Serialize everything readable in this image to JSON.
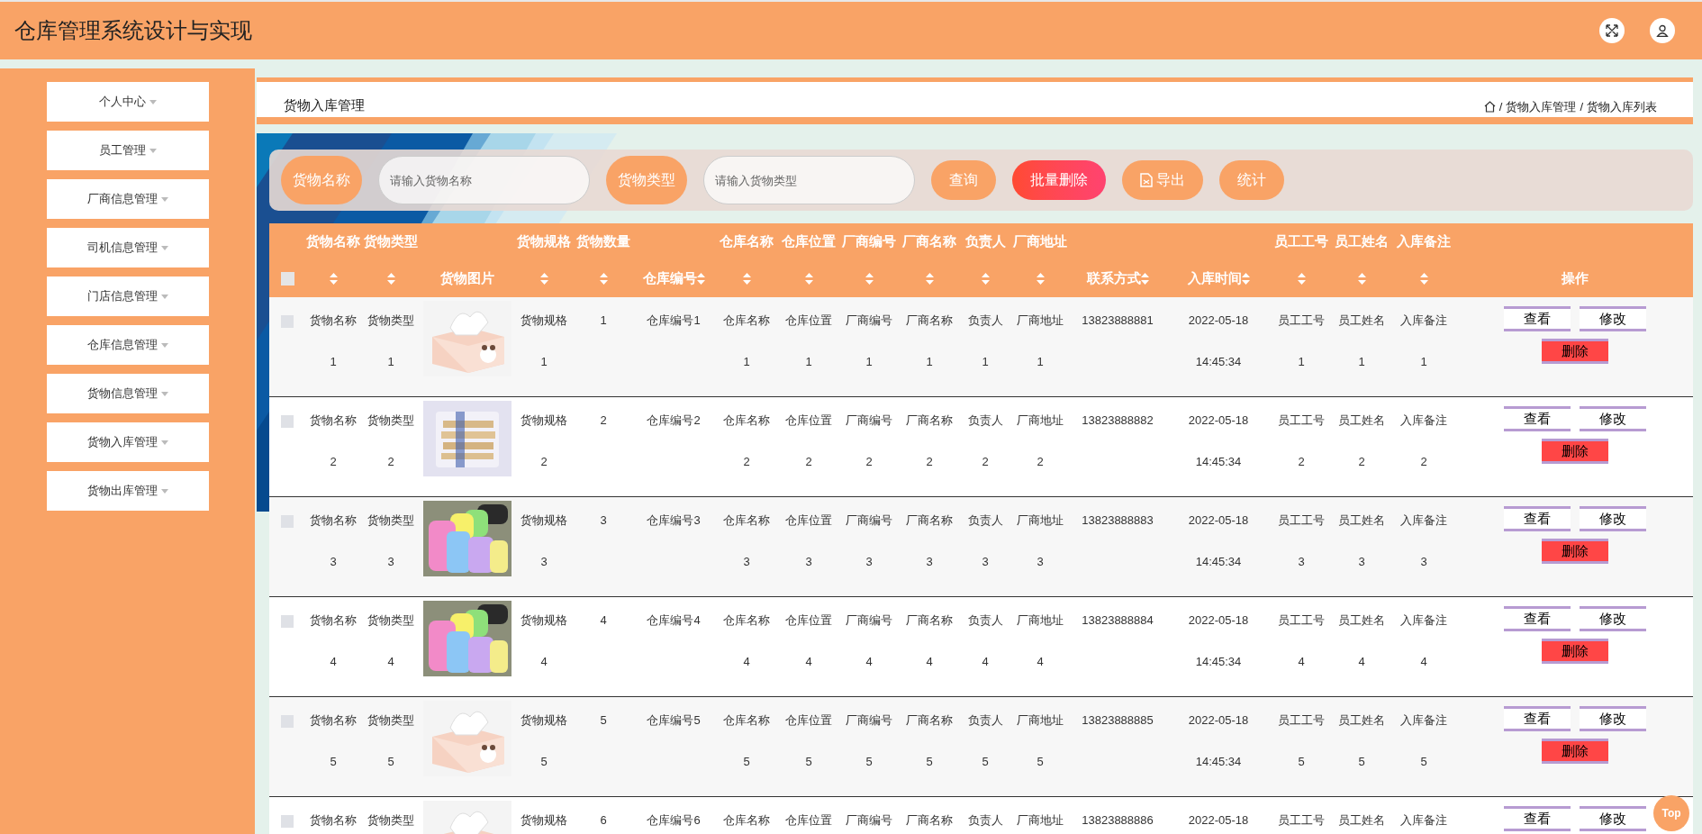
{
  "header": {
    "title": "仓库管理系统设计与实现"
  },
  "sidebar": {
    "items": [
      {
        "label": "个人中心"
      },
      {
        "label": "员工管理"
      },
      {
        "label": "厂商信息管理"
      },
      {
        "label": "司机信息管理"
      },
      {
        "label": "门店信息管理"
      },
      {
        "label": "仓库信息管理"
      },
      {
        "label": "货物信息管理"
      },
      {
        "label": "货物入库管理"
      },
      {
        "label": "货物出库管理"
      }
    ]
  },
  "page_title": "货物入库管理",
  "breadcrumb": {
    "separators": [
      "/",
      "/"
    ],
    "items": [
      "货物入库管理",
      "货物入库列表"
    ]
  },
  "search": {
    "fields": [
      {
        "label": "货物名称",
        "placeholder": "请输入货物名称"
      },
      {
        "label": "货物类型",
        "placeholder": "请输入货物类型"
      }
    ],
    "buttons": [
      {
        "label": "查询",
        "kind": "primary"
      },
      {
        "label": "批量删除",
        "kind": "danger"
      },
      {
        "label": "导出",
        "kind": "export"
      },
      {
        "label": "统计",
        "kind": "primary"
      }
    ]
  },
  "table": {
    "select_all": {
      "checked": false
    },
    "columns": [
      {
        "heading": "货物名称",
        "sortable": true
      },
      {
        "heading": "货物类型",
        "sortable": true
      },
      {
        "label": "货物图片",
        "sortable": false
      },
      {
        "heading": "货物规格",
        "sortable": true
      },
      {
        "heading": "货物数量",
        "sortable": true
      },
      {
        "label": "仓库编号",
        "sortable": true
      },
      {
        "heading": "仓库名称",
        "sortable": true
      },
      {
        "heading": "仓库位置",
        "sortable": true
      },
      {
        "heading": "厂商编号",
        "sortable": true
      },
      {
        "heading": "厂商名称",
        "sortable": true
      },
      {
        "heading": "负责人",
        "sortable": true
      },
      {
        "heading": "厂商地址",
        "sortable": true
      },
      {
        "label": "联系方式",
        "sortable": true
      },
      {
        "label": "入库时间",
        "sortable": true
      },
      {
        "heading": "员工工号",
        "sortable": true
      },
      {
        "heading": "员工姓名",
        "sortable": true
      },
      {
        "heading": "入库备注",
        "sortable": true
      },
      {
        "label": "操作",
        "sortable": false
      }
    ],
    "rows": [
      {
        "checked": false,
        "cells": [
          {
            "kind": "text",
            "lines": [
              "货物名称",
              "1"
            ]
          },
          {
            "kind": "text",
            "lines": [
              "货物类型",
              "1"
            ]
          },
          {
            "kind": "picture"
          },
          {
            "kind": "text",
            "lines": [
              "货物规格",
              "1"
            ]
          },
          {
            "kind": "text",
            "lines": [
              "1"
            ]
          },
          {
            "kind": "text",
            "lines": [
              "仓库编号1"
            ]
          },
          {
            "kind": "text",
            "lines": [
              "仓库名称",
              "1"
            ]
          },
          {
            "kind": "text",
            "lines": [
              "仓库位置",
              "1"
            ]
          },
          {
            "kind": "text",
            "lines": [
              "厂商编号",
              "1"
            ]
          },
          {
            "kind": "text",
            "lines": [
              "厂商名称",
              "1"
            ]
          },
          {
            "kind": "text",
            "lines": [
              "负责人",
              "1"
            ]
          },
          {
            "kind": "text",
            "lines": [
              "厂商地址",
              "1"
            ]
          },
          {
            "kind": "text",
            "lines": [
              "13823888881"
            ]
          },
          {
            "kind": "text",
            "lines": [
              "2022-05-18",
              "14:45:34"
            ]
          },
          {
            "kind": "text",
            "lines": [
              "员工工号",
              "1"
            ]
          },
          {
            "kind": "text",
            "lines": [
              "员工姓名",
              "1"
            ]
          },
          {
            "kind": "text",
            "lines": [
              "入库备注",
              "1"
            ]
          },
          {
            "kind": "actions",
            "buttons": [
              {
                "label": "查看",
                "kind": "view"
              },
              {
                "label": "修改",
                "kind": "edit"
              },
              {
                "label": "删除",
                "kind": "delete"
              }
            ]
          }
        ]
      },
      {
        "checked": false,
        "cells": [
          {
            "kind": "text",
            "lines": [
              "货物名称",
              "2"
            ]
          },
          {
            "kind": "text",
            "lines": [
              "货物类型",
              "2"
            ]
          },
          {
            "kind": "picture"
          },
          {
            "kind": "text",
            "lines": [
              "货物规格",
              "2"
            ]
          },
          {
            "kind": "text",
            "lines": [
              "2"
            ]
          },
          {
            "kind": "text",
            "lines": [
              "仓库编号2"
            ]
          },
          {
            "kind": "text",
            "lines": [
              "仓库名称",
              "2"
            ]
          },
          {
            "kind": "text",
            "lines": [
              "仓库位置",
              "2"
            ]
          },
          {
            "kind": "text",
            "lines": [
              "厂商编号",
              "2"
            ]
          },
          {
            "kind": "text",
            "lines": [
              "厂商名称",
              "2"
            ]
          },
          {
            "kind": "text",
            "lines": [
              "负责人",
              "2"
            ]
          },
          {
            "kind": "text",
            "lines": [
              "厂商地址",
              "2"
            ]
          },
          {
            "kind": "text",
            "lines": [
              "13823888882"
            ]
          },
          {
            "kind": "text",
            "lines": [
              "2022-05-18",
              "14:45:34"
            ]
          },
          {
            "kind": "text",
            "lines": [
              "员工工号",
              "2"
            ]
          },
          {
            "kind": "text",
            "lines": [
              "员工姓名",
              "2"
            ]
          },
          {
            "kind": "text",
            "lines": [
              "入库备注",
              "2"
            ]
          },
          {
            "kind": "actions",
            "buttons": [
              {
                "label": "查看",
                "kind": "view"
              },
              {
                "label": "修改",
                "kind": "edit"
              },
              {
                "label": "删除",
                "kind": "delete"
              }
            ]
          }
        ]
      },
      {
        "checked": false,
        "cells": [
          {
            "kind": "text",
            "lines": [
              "货物名称",
              "3"
            ]
          },
          {
            "kind": "text",
            "lines": [
              "货物类型",
              "3"
            ]
          },
          {
            "kind": "picture"
          },
          {
            "kind": "text",
            "lines": [
              "货物规格",
              "3"
            ]
          },
          {
            "kind": "text",
            "lines": [
              "3"
            ]
          },
          {
            "kind": "text",
            "lines": [
              "仓库编号3"
            ]
          },
          {
            "kind": "text",
            "lines": [
              "仓库名称",
              "3"
            ]
          },
          {
            "kind": "text",
            "lines": [
              "仓库位置",
              "3"
            ]
          },
          {
            "kind": "text",
            "lines": [
              "厂商编号",
              "3"
            ]
          },
          {
            "kind": "text",
            "lines": [
              "厂商名称",
              "3"
            ]
          },
          {
            "kind": "text",
            "lines": [
              "负责人",
              "3"
            ]
          },
          {
            "kind": "text",
            "lines": [
              "厂商地址",
              "3"
            ]
          },
          {
            "kind": "text",
            "lines": [
              "13823888883"
            ]
          },
          {
            "kind": "text",
            "lines": [
              "2022-05-18",
              "14:45:34"
            ]
          },
          {
            "kind": "text",
            "lines": [
              "员工工号",
              "3"
            ]
          },
          {
            "kind": "text",
            "lines": [
              "员工姓名",
              "3"
            ]
          },
          {
            "kind": "text",
            "lines": [
              "入库备注",
              "3"
            ]
          },
          {
            "kind": "actions",
            "buttons": [
              {
                "label": "查看",
                "kind": "view"
              },
              {
                "label": "修改",
                "kind": "edit"
              },
              {
                "label": "删除",
                "kind": "delete"
              }
            ]
          }
        ]
      },
      {
        "checked": false,
        "cells": [
          {
            "kind": "text",
            "lines": [
              "货物名称",
              "4"
            ]
          },
          {
            "kind": "text",
            "lines": [
              "货物类型",
              "4"
            ]
          },
          {
            "kind": "picture"
          },
          {
            "kind": "text",
            "lines": [
              "货物规格",
              "4"
            ]
          },
          {
            "kind": "text",
            "lines": [
              "4"
            ]
          },
          {
            "kind": "text",
            "lines": [
              "仓库编号4"
            ]
          },
          {
            "kind": "text",
            "lines": [
              "仓库名称",
              "4"
            ]
          },
          {
            "kind": "text",
            "lines": [
              "仓库位置",
              "4"
            ]
          },
          {
            "kind": "text",
            "lines": [
              "厂商编号",
              "4"
            ]
          },
          {
            "kind": "text",
            "lines": [
              "厂商名称",
              "4"
            ]
          },
          {
            "kind": "text",
            "lines": [
              "负责人",
              "4"
            ]
          },
          {
            "kind": "text",
            "lines": [
              "厂商地址",
              "4"
            ]
          },
          {
            "kind": "text",
            "lines": [
              "13823888884"
            ]
          },
          {
            "kind": "text",
            "lines": [
              "2022-05-18",
              "14:45:34"
            ]
          },
          {
            "kind": "text",
            "lines": [
              "员工工号",
              "4"
            ]
          },
          {
            "kind": "text",
            "lines": [
              "员工姓名",
              "4"
            ]
          },
          {
            "kind": "text",
            "lines": [
              "入库备注",
              "4"
            ]
          },
          {
            "kind": "actions",
            "buttons": [
              {
                "label": "查看",
                "kind": "view"
              },
              {
                "label": "修改",
                "kind": "edit"
              },
              {
                "label": "删除",
                "kind": "delete"
              }
            ]
          }
        ]
      },
      {
        "checked": false,
        "cells": [
          {
            "kind": "text",
            "lines": [
              "货物名称",
              "5"
            ]
          },
          {
            "kind": "text",
            "lines": [
              "货物类型",
              "5"
            ]
          },
          {
            "kind": "picture"
          },
          {
            "kind": "text",
            "lines": [
              "货物规格",
              "5"
            ]
          },
          {
            "kind": "text",
            "lines": [
              "5"
            ]
          },
          {
            "kind": "text",
            "lines": [
              "仓库编号5"
            ]
          },
          {
            "kind": "text",
            "lines": [
              "仓库名称",
              "5"
            ]
          },
          {
            "kind": "text",
            "lines": [
              "仓库位置",
              "5"
            ]
          },
          {
            "kind": "text",
            "lines": [
              "厂商编号",
              "5"
            ]
          },
          {
            "kind": "text",
            "lines": [
              "厂商名称",
              "5"
            ]
          },
          {
            "kind": "text",
            "lines": [
              "负责人",
              "5"
            ]
          },
          {
            "kind": "text",
            "lines": [
              "厂商地址",
              "5"
            ]
          },
          {
            "kind": "text",
            "lines": [
              "13823888885"
            ]
          },
          {
            "kind": "text",
            "lines": [
              "2022-05-18",
              "14:45:34"
            ]
          },
          {
            "kind": "text",
            "lines": [
              "员工工号",
              "5"
            ]
          },
          {
            "kind": "text",
            "lines": [
              "员工姓名",
              "5"
            ]
          },
          {
            "kind": "text",
            "lines": [
              "入库备注",
              "5"
            ]
          },
          {
            "kind": "actions",
            "buttons": [
              {
                "label": "查看",
                "kind": "view"
              },
              {
                "label": "修改",
                "kind": "edit"
              },
              {
                "label": "删除",
                "kind": "delete"
              }
            ]
          }
        ]
      },
      {
        "checked": false,
        "cells": [
          {
            "kind": "text",
            "lines": [
              "货物名称"
            ]
          },
          {
            "kind": "text",
            "lines": [
              "货物类型"
            ]
          },
          {
            "kind": "picture"
          },
          {
            "kind": "text",
            "lines": [
              "货物规格"
            ]
          },
          {
            "kind": "text",
            "lines": [
              "6"
            ]
          },
          {
            "kind": "text",
            "lines": [
              "仓库编号6"
            ]
          },
          {
            "kind": "text",
            "lines": [
              "仓库名称"
            ]
          },
          {
            "kind": "text",
            "lines": [
              "仓库位置"
            ]
          },
          {
            "kind": "text",
            "lines": [
              "厂商编号"
            ]
          },
          {
            "kind": "text",
            "lines": [
              "厂商名称"
            ]
          },
          {
            "kind": "text",
            "lines": [
              "负责人"
            ]
          },
          {
            "kind": "text",
            "lines": [
              "厂商地址"
            ]
          },
          {
            "kind": "text",
            "lines": [
              "13823888886"
            ]
          },
          {
            "kind": "text",
            "lines": [
              "2022-05-18"
            ]
          },
          {
            "kind": "text",
            "lines": [
              "员工工号"
            ]
          },
          {
            "kind": "text",
            "lines": [
              "员工姓名"
            ]
          },
          {
            "kind": "text",
            "lines": [
              "入库备注"
            ]
          },
          {
            "kind": "actions",
            "buttons": [
              {
                "label": "查看",
                "kind": "view"
              },
              {
                "label": "修改",
                "kind": "edit"
              }
            ]
          }
        ]
      }
    ]
  },
  "top_button": "Top"
}
